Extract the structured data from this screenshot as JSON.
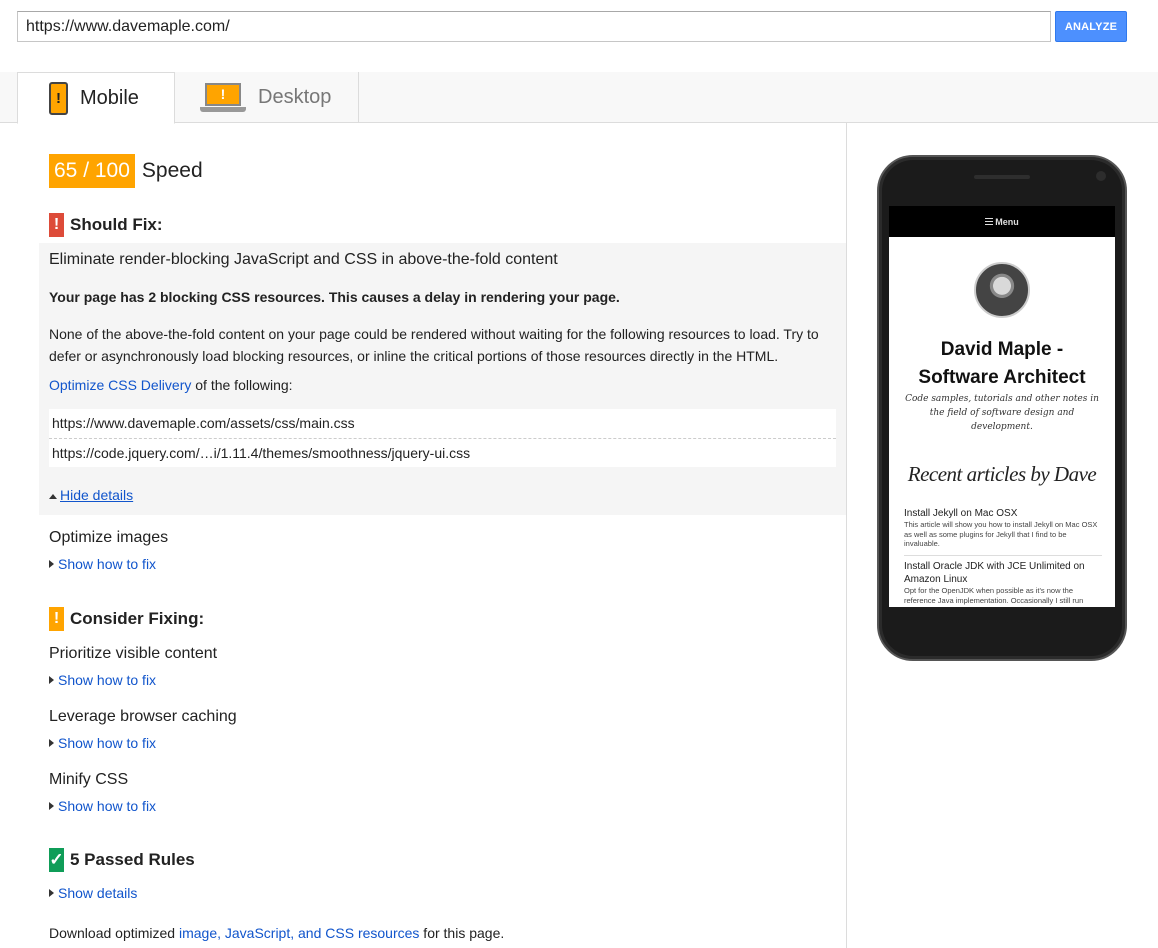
{
  "url_bar": {
    "value": "https://www.davemaple.com/",
    "analyze_label": "ANALYZE"
  },
  "tabs": [
    {
      "label": "Mobile",
      "icon": "mobile-warning-icon",
      "active": true
    },
    {
      "label": "Desktop",
      "icon": "desktop-warning-icon",
      "active": false
    }
  ],
  "score": {
    "value": "65 / 100",
    "label": "Speed",
    "color": "#ffa400"
  },
  "should_fix": {
    "heading": "Should Fix:",
    "badge": "!",
    "color": "#dd4b39",
    "expanded_rule": {
      "title": "Eliminate render-blocking JavaScript and CSS in above-the-fold content",
      "summary": "Your page has 2 blocking CSS resources. This causes a delay in rendering your page.",
      "body": "None of the above-the-fold content on your page could be rendered without waiting for the following resources to load. Try to defer or asynchronously load blocking resources, or inline the critical portions of those resources directly in the HTML.",
      "link_text": "Optimize CSS Delivery",
      "link_suffix": " of the following:",
      "resources": [
        "https://www.davemaple.com/assets/css/main.css",
        "https://code.jquery.com/…i/1.11.4/themes/smoothness/jquery-ui.css"
      ],
      "hide_label": "Hide details"
    },
    "other_rules": [
      {
        "title": "Optimize images",
        "toggle": "Show how to fix"
      }
    ]
  },
  "consider_fixing": {
    "heading": "Consider Fixing:",
    "badge": "!",
    "color": "#ffa400",
    "rules": [
      {
        "title": "Prioritize visible content",
        "toggle": "Show how to fix"
      },
      {
        "title": "Leverage browser caching",
        "toggle": "Show how to fix"
      },
      {
        "title": "Minify CSS",
        "toggle": "Show how to fix"
      }
    ]
  },
  "passed": {
    "heading": "5 Passed Rules",
    "badge": "✓",
    "color": "#0f9d58",
    "toggle": "Show details"
  },
  "footer": {
    "prefix": "Download optimized ",
    "link": "image, JavaScript, and CSS resources",
    "suffix": " for this page."
  },
  "phone_preview": {
    "menu_label": "Menu",
    "site_title_line1": "David Maple -",
    "site_title_line2": "Software Architect",
    "site_subtitle": "Code samples, tutorials and other notes in the field of software design and development.",
    "recent_heading": "Recent articles by Dave",
    "articles": [
      {
        "title": "Install Jekyll on Mac OSX",
        "desc": "This article will show you how to install Jekyll on Mac OSX as well as some plugins for Jekyll that I find to be invaluable."
      },
      {
        "title": "Install Oracle JDK with JCE Unlimited on Amazon Linux",
        "desc": "Opt for the OpenJDK when possible as it's now the reference Java implementation. Occasionally I still run"
      }
    ]
  }
}
